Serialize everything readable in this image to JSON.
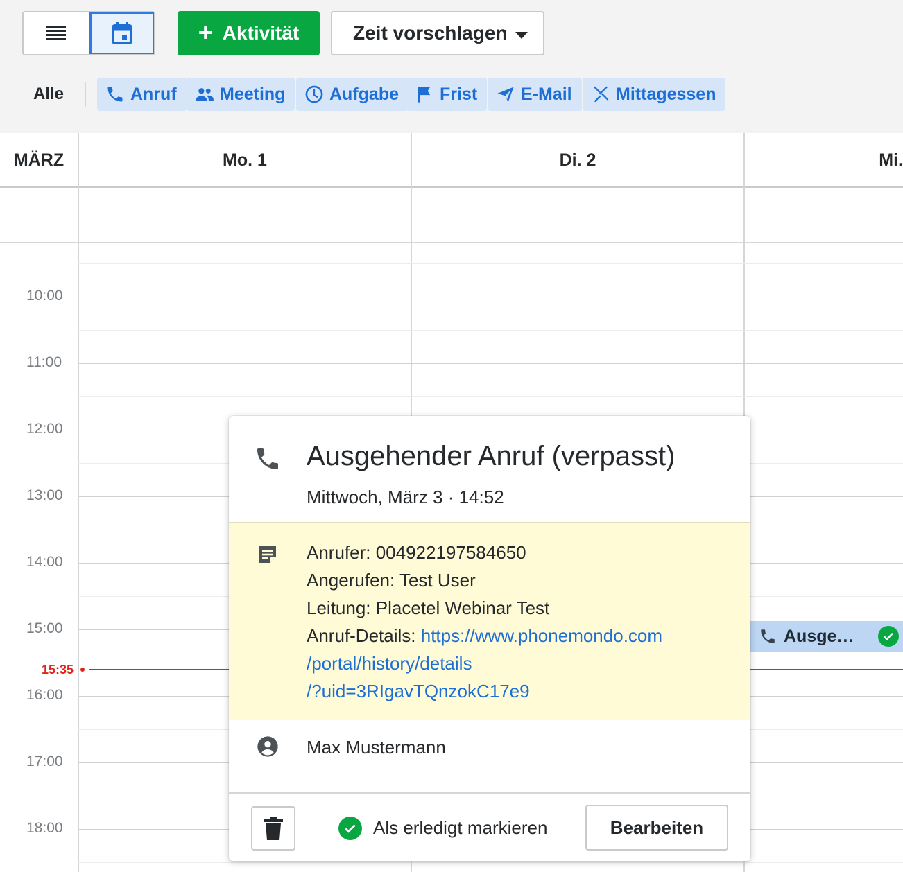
{
  "toolbar": {
    "view_list_icon": "list-icon",
    "view_calendar_icon": "calendar-icon",
    "add_activity_label": "Aktivität",
    "suggest_time_label": "Zeit vorschlagen"
  },
  "filters": {
    "all_label": "Alle",
    "chips": [
      {
        "label": "Anruf",
        "icon": "phone-icon"
      },
      {
        "label": "Meeting",
        "icon": "people-icon"
      },
      {
        "label": "Aufgabe",
        "icon": "clock-icon"
      },
      {
        "label": "Frist",
        "icon": "flag-icon"
      },
      {
        "label": "E-Mail",
        "icon": "send-icon"
      },
      {
        "label": "Mittagessen",
        "icon": "cutlery-icon"
      }
    ]
  },
  "calendar": {
    "month_label": "MÄRZ",
    "days": [
      "Mo. 1",
      "Di. 2",
      "Mi."
    ],
    "hours": [
      "10:00",
      "11:00",
      "12:00",
      "13:00",
      "14:00",
      "15:00",
      "16:00",
      "17:00",
      "18:00"
    ],
    "now_label": "15:35",
    "event_label": "Ausge…"
  },
  "popover": {
    "title": "Ausgehender Anruf (verpasst)",
    "subtitle": "Mittwoch, März 3 · 14:52",
    "note": {
      "caller": "Anrufer: 004922197584650",
      "called": "Angerufen: Test User",
      "line": "Leitung: Placetel Webinar Test",
      "details_prefix": "Anruf-Details: ",
      "link_part1": "https://www.phonemondo.com",
      "link_part2": "/portal/history/details",
      "link_part3": "/?uid=3RIgavTQnzokC17e9"
    },
    "person": "Max Mustermann",
    "mark_done_label": "Als erledigt markieren",
    "edit_label": "Bearbeiten"
  },
  "colors": {
    "accent_green": "#08a742",
    "chip_blue": "#1d6fd6",
    "now_red": "#e2231a",
    "note_yellow": "#fffbd7"
  }
}
